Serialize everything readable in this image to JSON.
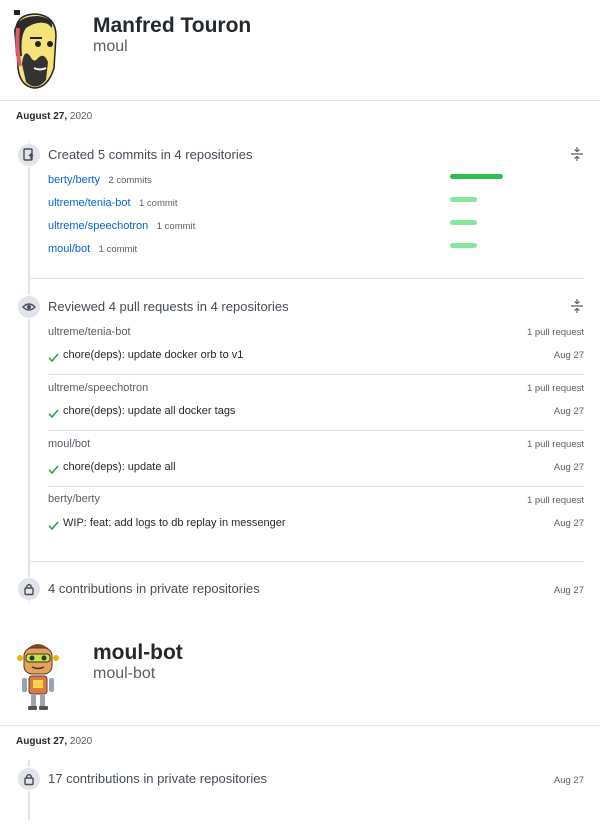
{
  "users": [
    {
      "name": "Manfred Touron",
      "login": "moul",
      "date_month_day": "August 27,",
      "date_year": "2020",
      "commits": {
        "title": "Created 5 commits in 4 repositories",
        "repos": [
          {
            "name": "berty/berty",
            "count": "2 commits",
            "share": 1.0
          },
          {
            "name": "ultreme/tenia-bot",
            "count": "1 commit",
            "share": 0.5
          },
          {
            "name": "ultreme/speechotron",
            "count": "1 commit",
            "share": 0.5
          },
          {
            "name": "moul/bot",
            "count": "1 commit",
            "share": 0.5
          }
        ]
      },
      "reviews": {
        "title": "Reviewed 4 pull requests in 4 repositories",
        "groups": [
          {
            "repo": "ultreme/tenia-bot",
            "count": "1 pull request",
            "pr": "chore(deps): update docker orb to v1",
            "date": "Aug 27"
          },
          {
            "repo": "ultreme/speechotron",
            "count": "1 pull request",
            "pr": "chore(deps): update all docker tags",
            "date": "Aug 27"
          },
          {
            "repo": "moul/bot",
            "count": "1 pull request",
            "pr": "chore(deps): update all",
            "date": "Aug 27"
          },
          {
            "repo": "berty/berty",
            "count": "1 pull request",
            "pr": "WIP: feat: add logs to db replay in messenger",
            "date": "Aug 27"
          }
        ]
      },
      "private": {
        "title": "4 contributions in private repositories",
        "date": "Aug 27"
      }
    },
    {
      "name": "moul-bot",
      "login": "moul-bot",
      "date_month_day": "August 27,",
      "date_year": "2020",
      "private": {
        "title": "17 contributions in private repositories",
        "date": "Aug 27"
      }
    }
  ],
  "colors": {
    "bar_full": "#2cbe4e",
    "bar_light": "#85e89d",
    "link": "#0366d6",
    "check": "#28a745"
  }
}
